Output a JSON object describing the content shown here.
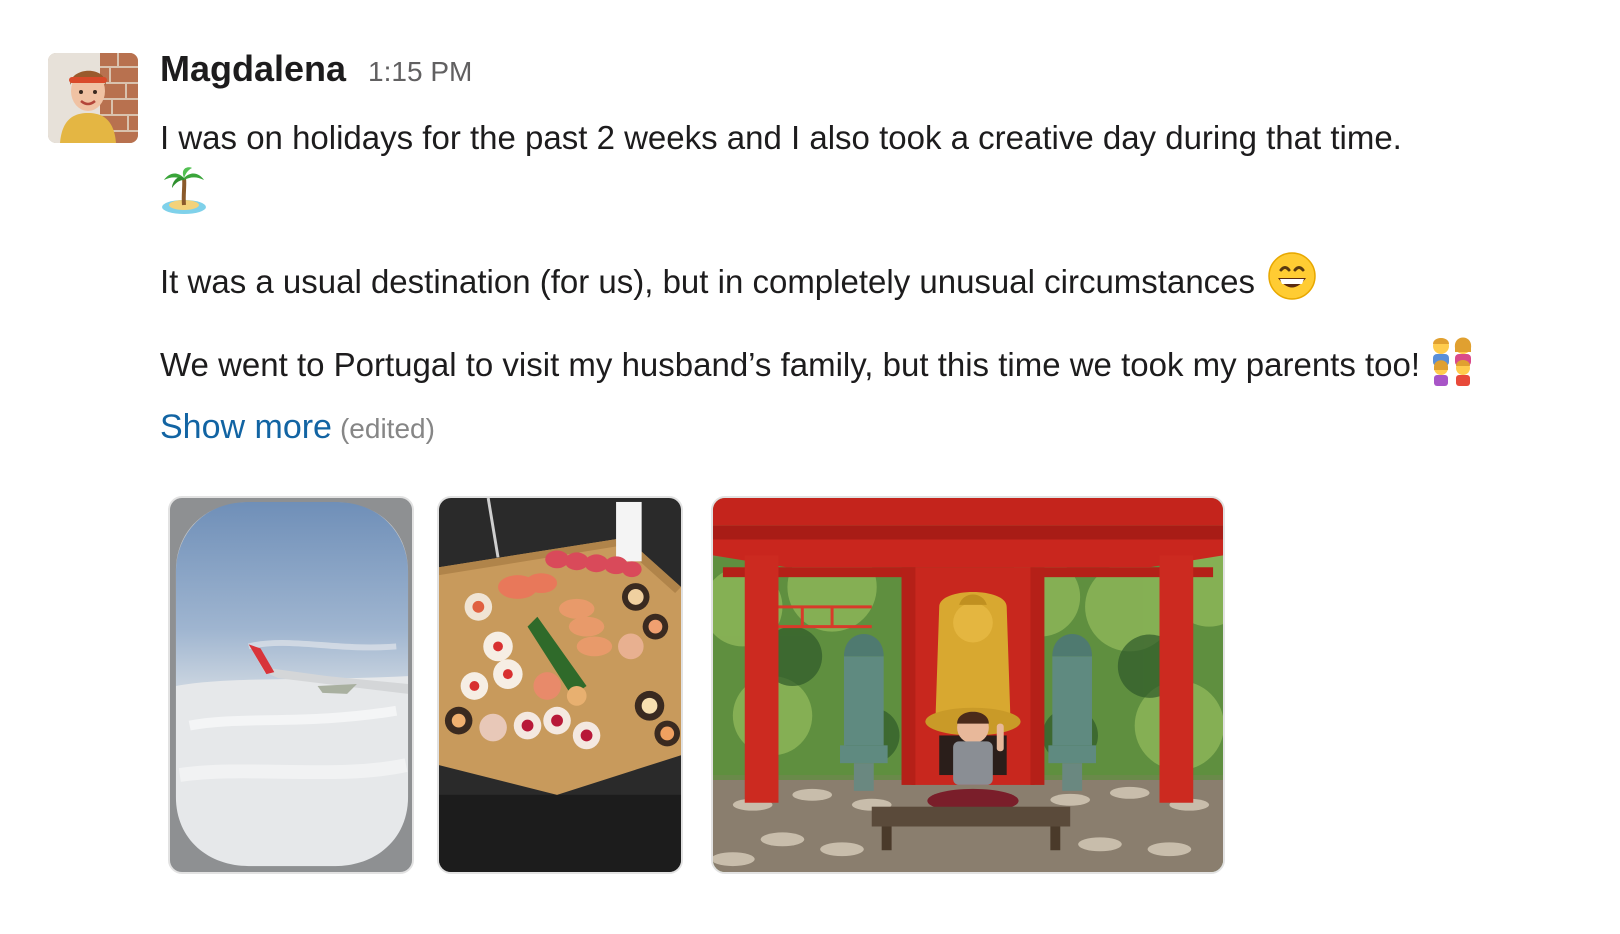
{
  "message": {
    "author": "Magdalena",
    "timestamp": "1:15 PM",
    "paragraphs": {
      "p1": "I was on holidays for the past 2 weeks and I also took a creative day during that time.",
      "p2": "It was a usual destination (for us), but in completely unusual circumstances",
      "p3": "We went to Portugal to visit my husband’s family, but this time we took my parents too!"
    },
    "emojis": {
      "p1": "desert-island-emoji",
      "p2": "grinning-face-emoji",
      "p3": "family-emoji"
    },
    "show_more_label": "Show more",
    "edited_label": "(edited)"
  },
  "attachments": [
    {
      "name": "airplane-window-photo"
    },
    {
      "name": "sushi-platter-photo"
    },
    {
      "name": "buddha-pagoda-photo"
    }
  ],
  "colors": {
    "link": "#1264a3",
    "text": "#1d1c1d",
    "muted": "#616061",
    "pagoda_red": "#c8201a"
  }
}
